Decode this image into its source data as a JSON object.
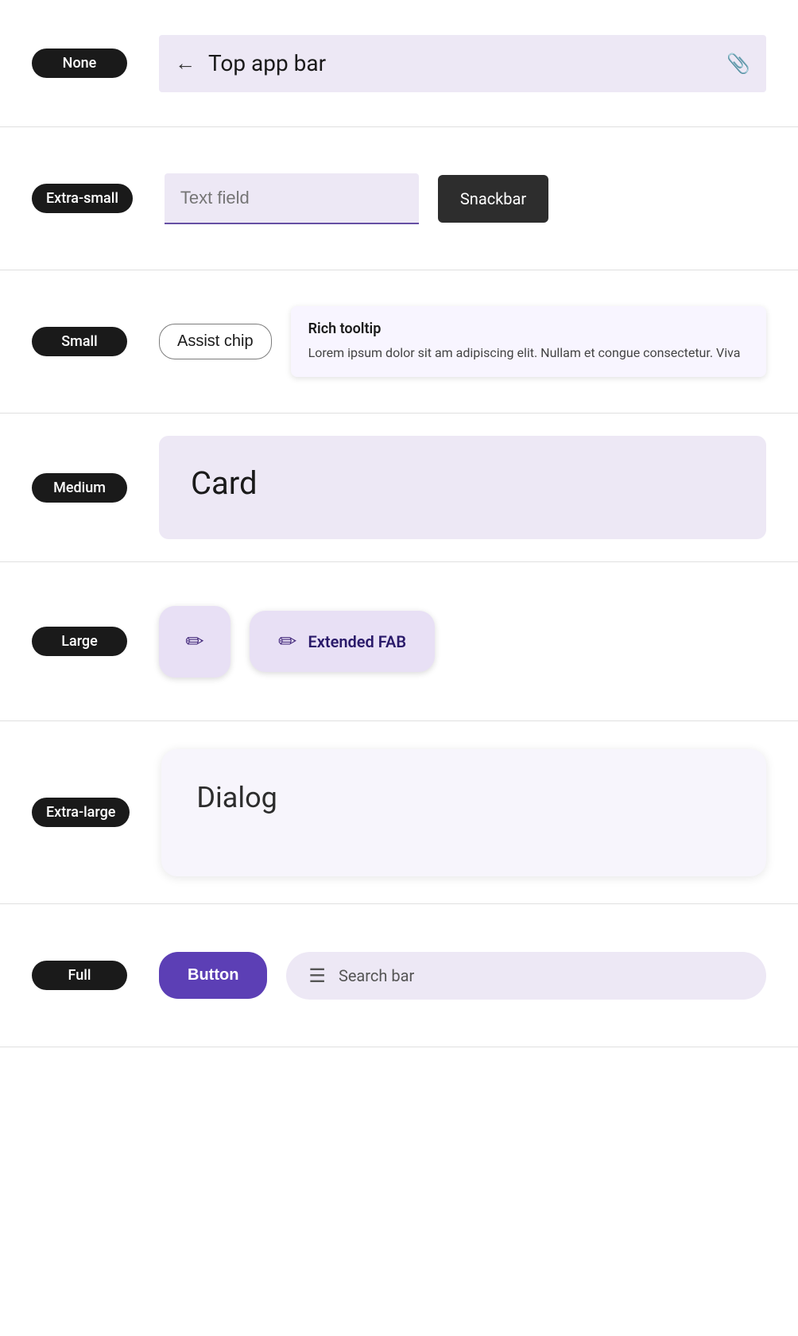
{
  "rows": [
    {
      "id": "none",
      "badge": "None",
      "components": {
        "top_app_bar": {
          "title": "Top app bar",
          "back_icon": "←",
          "attach_icon": "📎"
        }
      }
    },
    {
      "id": "extra-small",
      "badge": "Extra-small",
      "components": {
        "text_field": {
          "placeholder": "Text field"
        },
        "snackbar": {
          "label": "Snackbar"
        }
      }
    },
    {
      "id": "small",
      "badge": "Small",
      "components": {
        "assist_chip": {
          "label": "Assist chip"
        },
        "rich_tooltip": {
          "title": "Rich tooltip",
          "body": "Lorem ipsum dolor sit am adipiscing elit. Nullam et congue consectetur. Viva"
        }
      }
    },
    {
      "id": "medium",
      "badge": "Medium",
      "components": {
        "card": {
          "title": "Card"
        }
      }
    },
    {
      "id": "large",
      "badge": "Large",
      "components": {
        "fab": {
          "icon": "✏"
        },
        "extended_fab": {
          "icon": "✏",
          "label": "Extended FAB"
        }
      }
    },
    {
      "id": "extra-large",
      "badge": "Extra-large",
      "components": {
        "dialog": {
          "title": "Dialog"
        }
      }
    },
    {
      "id": "full",
      "badge": "Full",
      "components": {
        "button": {
          "label": "Button"
        },
        "search_bar": {
          "icon": "☰",
          "label": "Search bar"
        }
      }
    }
  ]
}
